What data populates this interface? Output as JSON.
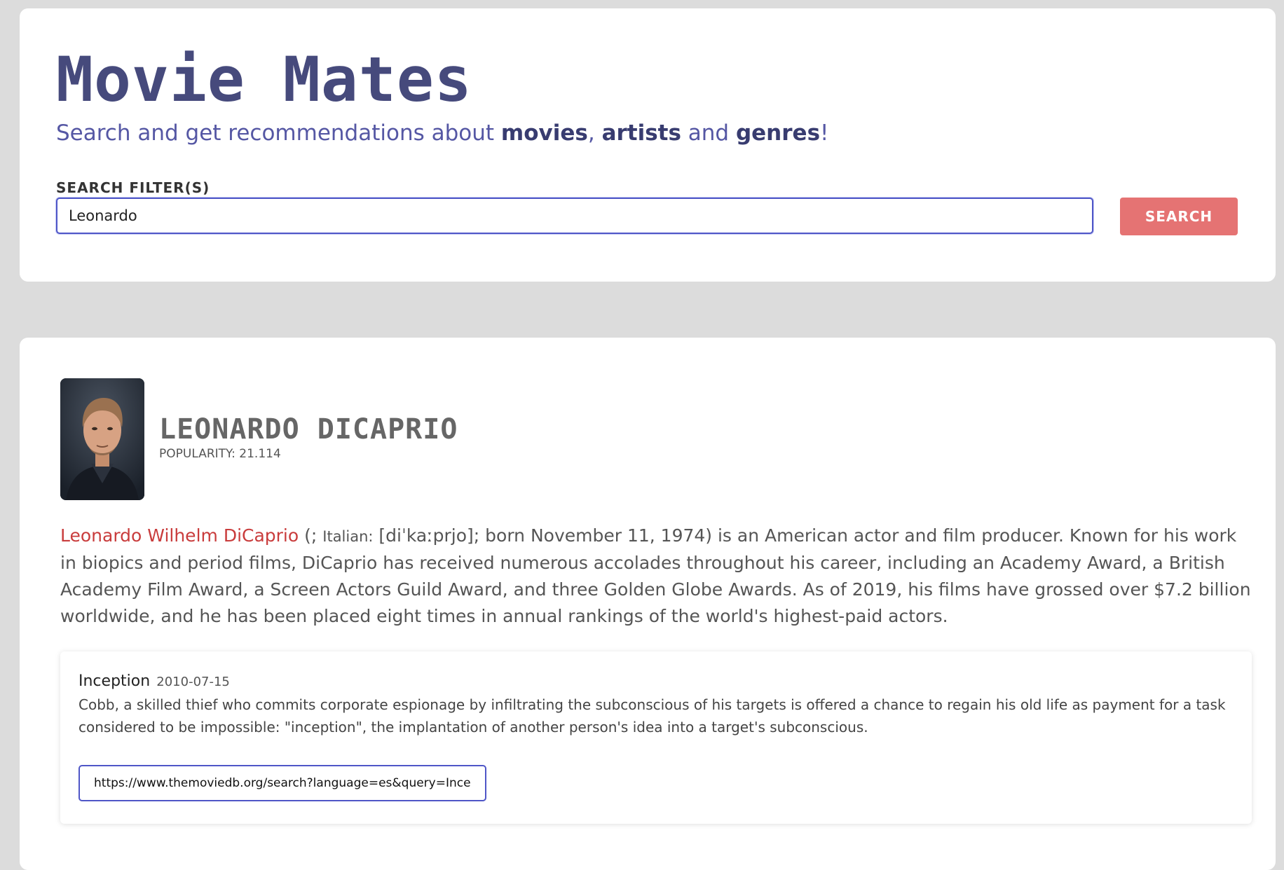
{
  "header": {
    "title": "Movie Mates",
    "subtitle": {
      "prefix": "Search and get recommendations about ",
      "movies": "movies",
      "comma": ",",
      "artists": "artists",
      "and": " and ",
      "genres": "genres",
      "exclaim": "!"
    }
  },
  "search": {
    "label": "SEARCH FILTER(S)",
    "value": "Leonardo",
    "button_label": "SEARCH"
  },
  "colors": {
    "title": "#464a7c",
    "accent": "#4f56c7",
    "search_button": "#e57373",
    "bio_name": "#c93c3c"
  },
  "artist": {
    "name": "LEONARDO DICAPRIO",
    "popularity": "POPULARITY: 21.114",
    "bio": {
      "name": "Leonardo Wilhelm DiCaprio",
      "paren_open": " (; ",
      "language": "Italian:",
      "text": " [diˈkaːprjo]; born November 11, 1974) is an American actor and film producer. Known for his work in biopics and period films, DiCaprio has received numerous accolades throughout his career, including an Academy Award, a British Academy Film Award, a Screen Actors Guild Award, and three Golden Globe Awards. As of 2019, his films have grossed over $7.2 billion worldwide, and he has been placed eight times in annual rankings of the world's highest-paid actors."
    }
  },
  "movies": [
    {
      "title": "Inception",
      "date": "2010-07-15",
      "overview": "Cobb, a skilled thief who commits corporate espionage by infiltrating the subconscious of his targets is offered a chance to regain his old life as payment for a task considered to be impossible: \"inception\", the implantation of another person's idea into a target's subconscious.",
      "link": "https://www.themoviedb.org/search?language=es&query=Inception"
    }
  ]
}
